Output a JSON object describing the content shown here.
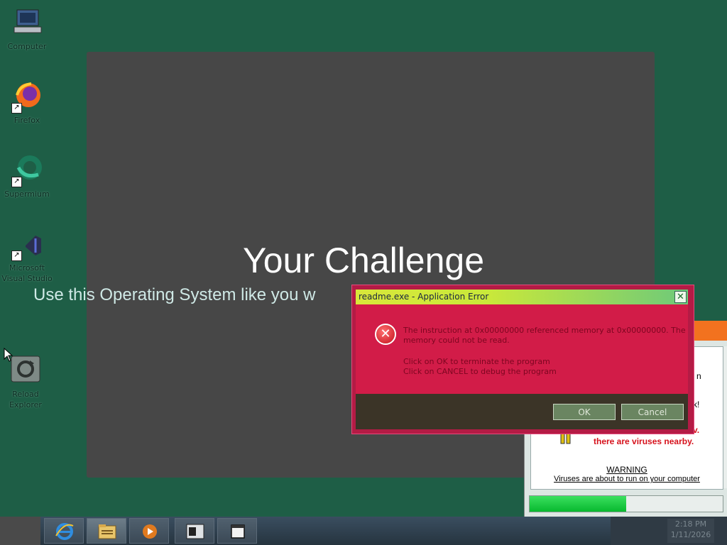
{
  "desktop": {
    "icons": [
      {
        "label": "Computer",
        "icon": "computer-icon"
      },
      {
        "label": "Firefox",
        "icon": "firefox-icon"
      },
      {
        "label": "Supermium",
        "icon": "supermium-icon"
      },
      {
        "label": "Microsoft Visual Studio",
        "icon": "visual-studio-icon"
      },
      {
        "label": "Reload Explorer",
        "icon": "reload-explorer-icon"
      }
    ]
  },
  "challenge": {
    "title": "Your Challenge",
    "subtitle": "Use this Operating System like you w"
  },
  "error_dialog": {
    "title": "readme.exe - Application Error",
    "close_label": "✕",
    "message_line1": "The instruction at 0x00000000 referenced memory at 0x00000000. The",
    "message_line2": "memory could not be read.",
    "message_line3": "Click on OK to terminate the program",
    "message_line4": "Click on CANCEL to debug the program",
    "ok_label": "OK",
    "cancel_label": "Cancel",
    "icon": "error-icon"
  },
  "virus_window": {
    "frag1": "n",
    "frag2": "k!",
    "frag3": "v.",
    "message": "there are viruses nearby.",
    "warning": "WARNING",
    "warning_sub": "Viruses are about to run on your computer",
    "progress": 0.5
  },
  "taskbar": {
    "items": [
      "internet-explorer-icon",
      "file-explorer-icon",
      "media-player-icon",
      "terminal-icon",
      "folder-icon"
    ],
    "time": "2:18 PM",
    "date": "1/11/2026"
  },
  "colors": {
    "desktop": "#1e5e46",
    "panel": "#474747",
    "error_body": "#d21c48",
    "titlebar_green": "#c9e83a",
    "virus_red": "#d6121c"
  }
}
